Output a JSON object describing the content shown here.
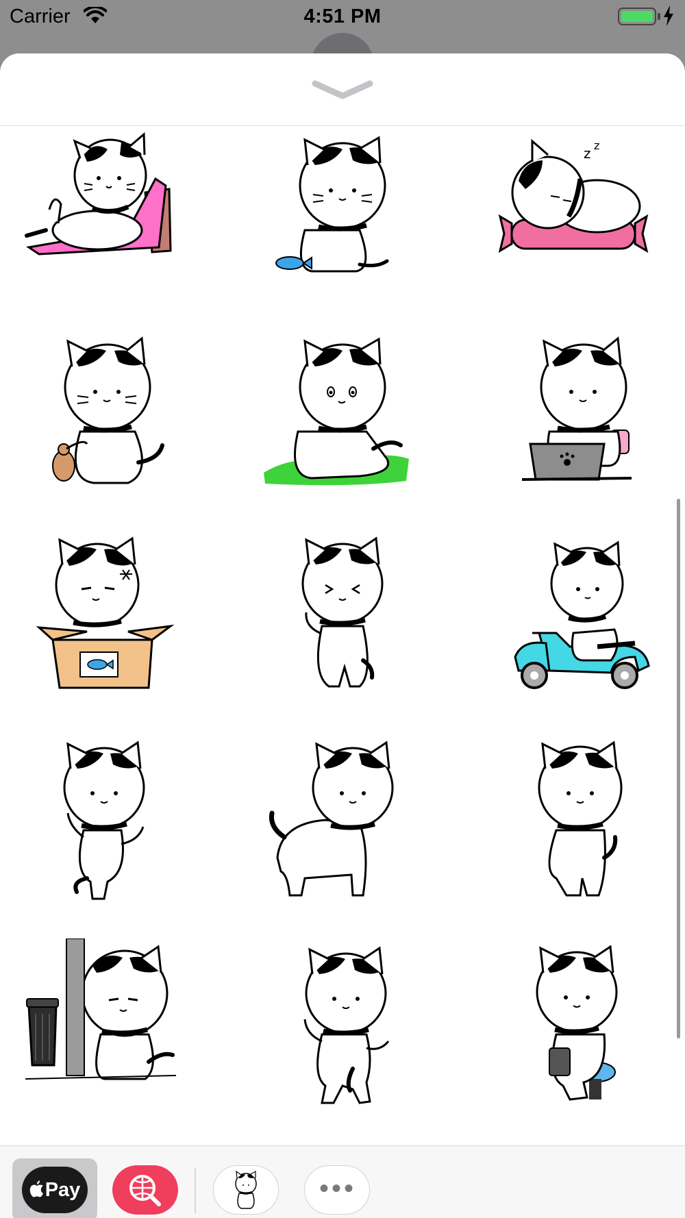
{
  "status_bar": {
    "carrier": "Carrier",
    "time": "4:51 PM",
    "battery_color": "#4cd964"
  },
  "sheet": {
    "collapse_icon": "chevron-down-icon"
  },
  "stickers": [
    {
      "name": "sticker-cat-lounging-pink-chair"
    },
    {
      "name": "sticker-cat-sitting-with-fish"
    },
    {
      "name": "sticker-cat-sleeping-on-pillow"
    },
    {
      "name": "sticker-cat-with-mouse"
    },
    {
      "name": "sticker-cat-sitting-on-grass"
    },
    {
      "name": "sticker-cat-with-laptop"
    },
    {
      "name": "sticker-cat-in-box-angry"
    },
    {
      "name": "sticker-cat-standing-squint"
    },
    {
      "name": "sticker-cat-riding-scooter"
    },
    {
      "name": "sticker-cat-dancing"
    },
    {
      "name": "sticker-cat-walking"
    },
    {
      "name": "sticker-cat-standing"
    },
    {
      "name": "sticker-cat-hiding-behind-pole"
    },
    {
      "name": "sticker-cat-waving"
    },
    {
      "name": "sticker-cat-sitting-with-tablet"
    }
  ],
  "drawer": {
    "apple_pay_label": "Pay",
    "search_icon": "globe-search-icon",
    "sticker_app_icon": "cat-sticker-app-icon",
    "more_icon": "more-icon",
    "more_label": "•••",
    "accent_color": "#f03e5d"
  }
}
